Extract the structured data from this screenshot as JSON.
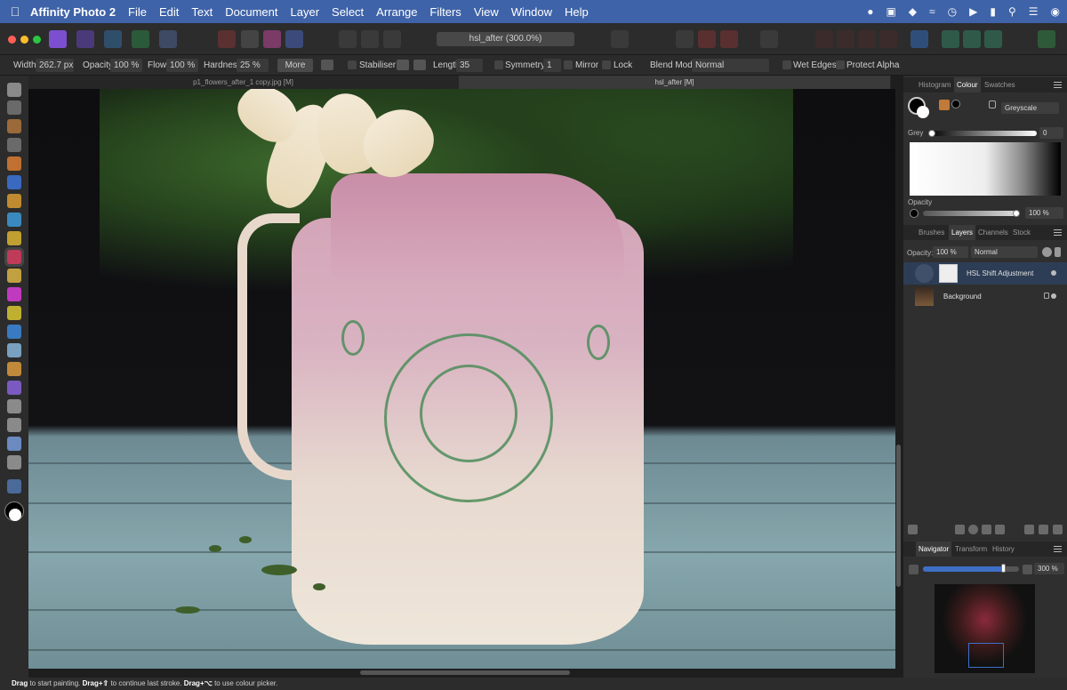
{
  "menubar": {
    "apple": "",
    "app_name": "Affinity Photo 2",
    "items": [
      "File",
      "Edit",
      "Text",
      "Document",
      "Layer",
      "Select",
      "Arrange",
      "Filters",
      "View",
      "Window",
      "Help"
    ],
    "status_icons": [
      "creative-cloud-icon",
      "device-icon",
      "vpn-icon",
      "wifi-icon",
      "clock-icon",
      "play-icon",
      "battery-icon",
      "search-icon",
      "control-center-icon",
      "siri-icon"
    ]
  },
  "toolbar": {
    "document_title": "hsl_after (300.0%)"
  },
  "context": {
    "width_label": "Width:",
    "width_value": "262.7 px",
    "opacity_label": "Opacity:",
    "opacity_value": "100 %",
    "flow_label": "Flow:",
    "flow_value": "100 %",
    "hardness_label": "Hardness:",
    "hardness_value": "25 %",
    "more_label": "More",
    "stabiliser_label": "Stabiliser",
    "length_label": "Length:",
    "length_value": "35",
    "symmetry_label": "Symmetry",
    "symmetry_value": "1",
    "mirror_label": "Mirror",
    "lock_label": "Lock",
    "blend_mode_label": "Blend Mode:",
    "blend_mode_value": "Normal",
    "wet_edges_label": "Wet Edges",
    "protect_alpha_label": "Protect Alpha"
  },
  "tabs": [
    {
      "label": "p1_flowers_after_1 copy.jpg [M]",
      "active": false
    },
    {
      "label": "hsl_after [M]",
      "active": true
    }
  ],
  "colour_panel": {
    "tabs": [
      "Histogram",
      "Colour",
      "Swatches"
    ],
    "active_tab": "Colour",
    "model": "Greyscale",
    "grey_label": "Grey",
    "grey_value": "0",
    "opacity_label": "Opacity",
    "opacity_value": "100 %"
  },
  "layers_panel": {
    "tabs": [
      "Brushes",
      "Layers",
      "Channels",
      "Stock"
    ],
    "active_tab": "Layers",
    "opacity_label": "Opacity:",
    "opacity_value": "100 %",
    "blend_mode": "Normal",
    "layers": [
      {
        "name": "HSL Shift Adjustment",
        "selected": true
      },
      {
        "name": "Background",
        "selected": false,
        "locked": true
      }
    ]
  },
  "navigator_panel": {
    "tabs": [
      "Navigator",
      "Transform",
      "History"
    ],
    "active_tab": "Navigator",
    "zoom_value": "300 %",
    "zoom_level": 0.83
  },
  "status_bar": {
    "part1_bold": "Drag",
    "part1": " to start painting. ",
    "part2_bold": "Drag+⇧",
    "part2": " to continue last stroke. ",
    "part3_bold": "Drag+⌥",
    "part3": " to use colour picker."
  },
  "colors": {
    "menubar": "#3f63a8",
    "panel_bg": "#2f2f2f",
    "accent": "#3d6fc5",
    "selected_layer": "#2d3d55"
  }
}
